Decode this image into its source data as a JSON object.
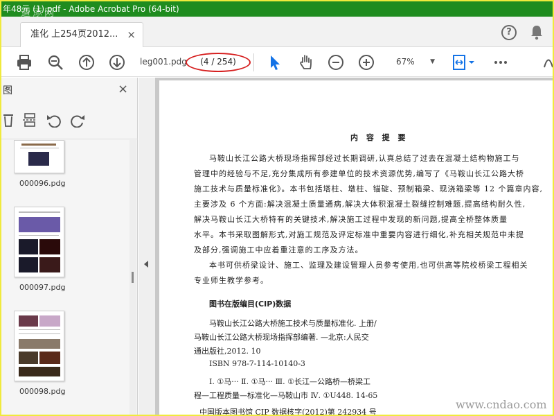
{
  "window": {
    "title": "年48元 (1).pdf - Adobe Acrobat Pro (64-bit)"
  },
  "tabs": [
    {
      "label": "准化 上254页2012...",
      "close": "×"
    }
  ],
  "toolbar": {
    "page_name": "leg001.pdg",
    "page_count": "(4 / 254)",
    "zoom": "67%",
    "icons": [
      "print-icon",
      "zoom-out-search-icon",
      "page-up-icon",
      "page-down-icon",
      "select-cursor-icon",
      "hand-icon",
      "zoom-minus-icon",
      "zoom-plus-icon",
      "fit-page-icon",
      "more-icon"
    ]
  },
  "left_panel": {
    "title": "图",
    "close": "×",
    "thumbnails": [
      {
        "label": "000096.pdg"
      },
      {
        "label": "000097.pdg"
      },
      {
        "label": "000098.pdg"
      }
    ]
  },
  "document": {
    "heading": "内 容 提 要",
    "paragraph_lines": [
      "马鞍山长江公路大桥现场指挥部经过长期调研,认真总结了过去在混凝土结构物施工与",
      "管理中的经验与不足,充分集成所有参建单位的技术资源优势,编写了《马鞍山长江公路大桥",
      "施工技术与质量标准化》。本书包括塔柱、墩柱、锚碇、预制箱梁、现浇箱梁等 12 个篇章内容,",
      "主要涉及 6 个方面:解决混凝土质量通病,解决大体积混凝土裂缝控制难题,提高结构耐久性,",
      "解决马鞍山长江大桥特有的关键技术,解决施工过程中发现的新问题,提高全桥整体质量",
      "水平。本书采取图解形式,对施工规范及评定标准中重要内容进行细化,补充相关规范中未提",
      "及部分,强调施工中应着重注意的工序及方法。",
      "本书可供桥梁设计、施工、监理及建设管理人员参考使用,也可供高等院校桥梁工程相关",
      "专业师生教学参考。"
    ],
    "cip_title": "图书在版编目(CIP)数据",
    "cip_lines": [
      "马鞍山长江公路大桥施工技术与质量标准化. 上册/",
      "马鞍山长江公路大桥现场指挥部编著. —北京:人民交",
      "通出版社,2012. 10",
      "ISBN 978-7-114-10140-3",
      "Ⅰ. ①马···  Ⅱ. ①马···  Ⅲ. ①长江—公路桥—桥梁工",
      "程—工程质量—标准化—马鞍山市  Ⅳ. ①U448. 14-65",
      "中国版本图书馆 CIP 数据核字(2012)第 242934 号"
    ]
  },
  "watermarks": {
    "top_left": "道添网",
    "bottom_right": "www.cndao.com"
  },
  "colors": {
    "title_bar": "#1f8c1f",
    "frame": "#f0ea3c",
    "highlight_oval": "#d61f1f",
    "select_tool": "#1473e6"
  }
}
